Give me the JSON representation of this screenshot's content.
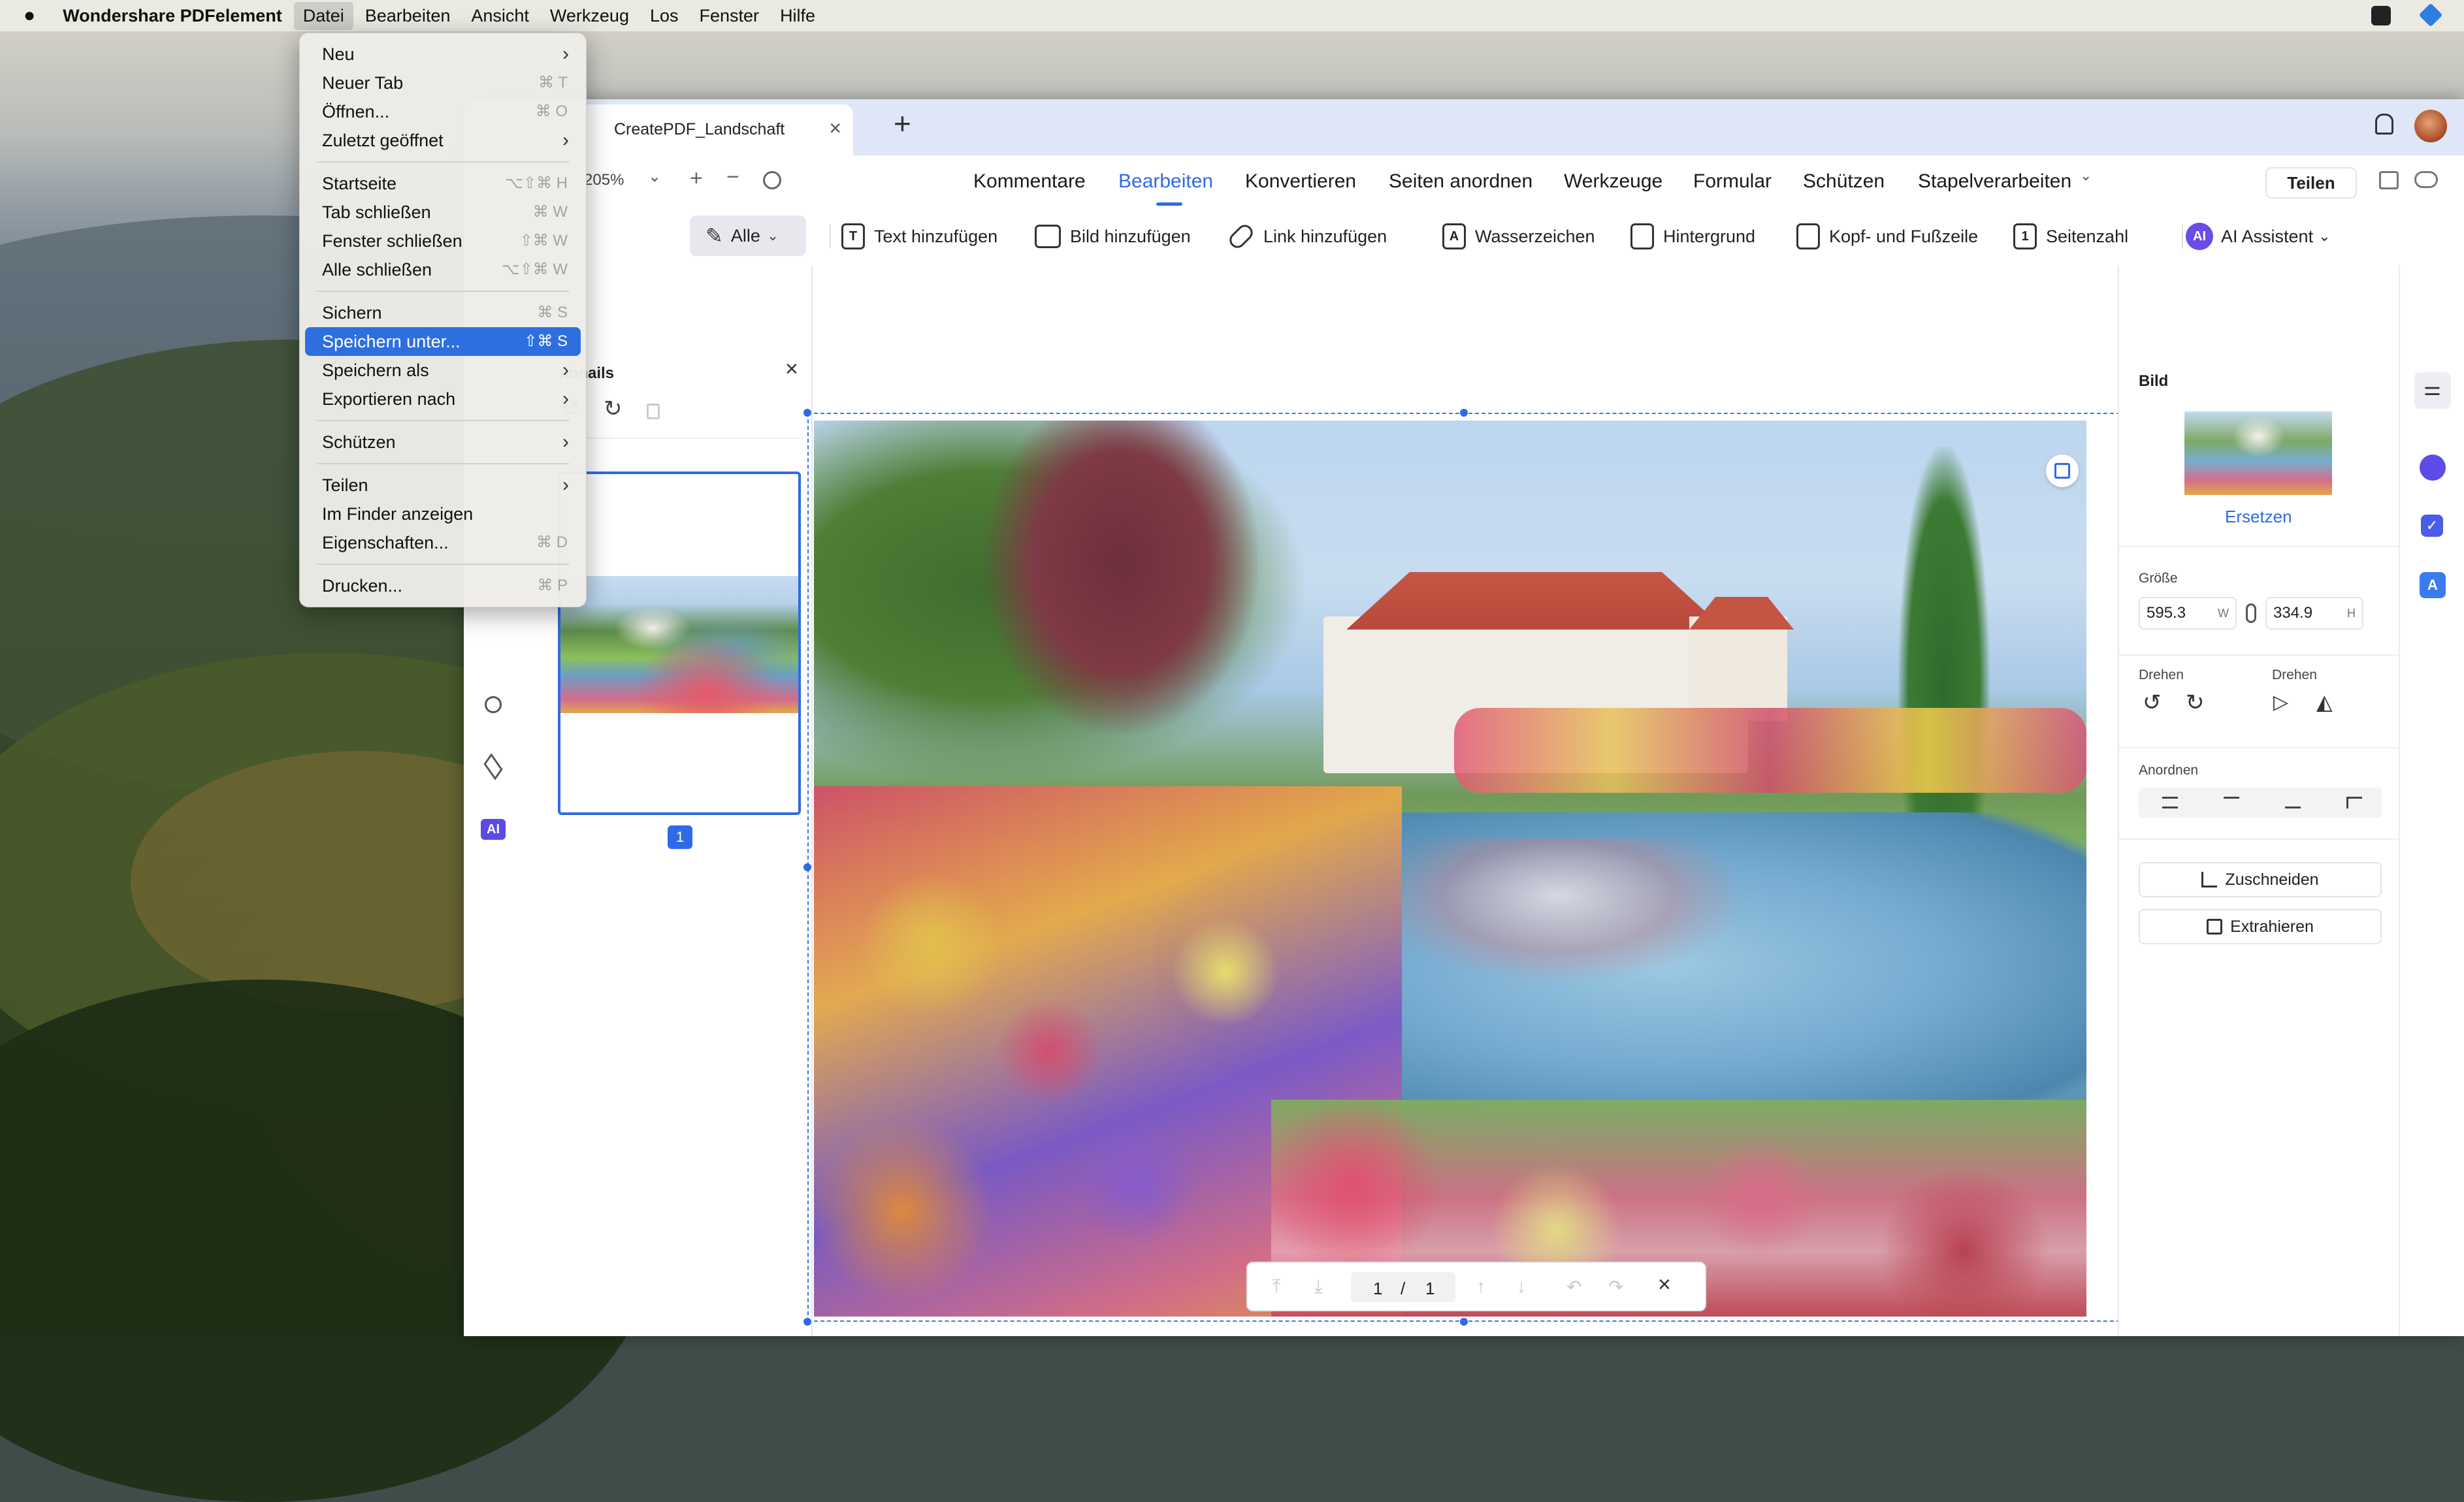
{
  "menubar": {
    "app_name": "Wondershare PDFelement",
    "items": [
      "Datei",
      "Bearbeiten",
      "Ansicht",
      "Werkzeug",
      "Los",
      "Fenster",
      "Hilfe"
    ]
  },
  "tab": {
    "title": "CreatePDF_Landschaft",
    "close": "×",
    "new": "+"
  },
  "toolbar": {
    "zoom": "205%",
    "nav_tabs": [
      "Kommentare",
      "Bearbeiten",
      "Konvertieren",
      "Seiten anordnen",
      "Werkzeuge",
      "Formular",
      "Schützen",
      "Stapelverarbeiten"
    ],
    "selected_tab": "Bearbeiten",
    "share_button": "Teilen",
    "select_all": "Alle",
    "edit_tools": [
      "Text hinzufügen",
      "Bild hinzufügen",
      "Link hinzufügen",
      "Wasserzeichen",
      "Hintergrund",
      "Kopf- und Fußzeile",
      "Seitenzahl"
    ],
    "ai_assistant": "AI Assistent",
    "ai_badge": "AI"
  },
  "thumbnail_panel": {
    "title_visible": "nbnails",
    "page_number": "1"
  },
  "rail": {
    "ai_label": "AI"
  },
  "right_panel": {
    "section_title": "Bild",
    "replace_link": "Ersetzen",
    "size_label": "Größe",
    "width": "595.3",
    "width_unit": "W",
    "height": "334.9",
    "height_unit": "H",
    "rotate_label": "Drehen",
    "flip_label": "Drehen",
    "arrange_label": "Anordnen",
    "crop_button": "Zuschneiden",
    "extract_button": "Extrahieren"
  },
  "page_nav": {
    "current": "1",
    "separator": "/",
    "total": "1"
  },
  "file_menu": {
    "items": [
      {
        "label": "Neu",
        "shortcut": "",
        "submenu": true
      },
      {
        "label": "Neuer Tab",
        "shortcut": "⌘ T",
        "submenu": false
      },
      {
        "label": "Öffnen...",
        "shortcut": "⌘ O",
        "submenu": false
      },
      {
        "label": "Zuletzt geöffnet",
        "shortcut": "",
        "submenu": true
      },
      {
        "label": "Startseite",
        "shortcut": "⌥⇧⌘ H",
        "submenu": false
      },
      {
        "label": "Tab schließen",
        "shortcut": "⌘ W",
        "submenu": false
      },
      {
        "label": "Fenster schließen",
        "shortcut": "⇧⌘ W",
        "submenu": false
      },
      {
        "label": "Alle schließen",
        "shortcut": "⌥⇧⌘ W",
        "submenu": false
      },
      {
        "label": "Sichern",
        "shortcut": "⌘ S",
        "submenu": false
      },
      {
        "label": "Speichern unter...",
        "shortcut": "⇧⌘ S",
        "submenu": false
      },
      {
        "label": "Speichern als",
        "shortcut": "",
        "submenu": true
      },
      {
        "label": "Exportieren nach",
        "shortcut": "",
        "submenu": true
      },
      {
        "label": "Schützen",
        "shortcut": "",
        "submenu": true
      },
      {
        "label": "Teilen",
        "shortcut": "",
        "submenu": true
      },
      {
        "label": "Im Finder anzeigen",
        "shortcut": "",
        "submenu": false
      },
      {
        "label": "Eigenschaften...",
        "shortcut": "⌘ D",
        "submenu": false
      },
      {
        "label": "Drucken...",
        "shortcut": "⌘ P",
        "submenu": false
      }
    ],
    "highlighted": "Speichern unter..."
  },
  "colors": {
    "accent": "#2f6ae6",
    "menu_highlight": "#2e6fe0",
    "ai_purple": "#6b4ce6"
  }
}
